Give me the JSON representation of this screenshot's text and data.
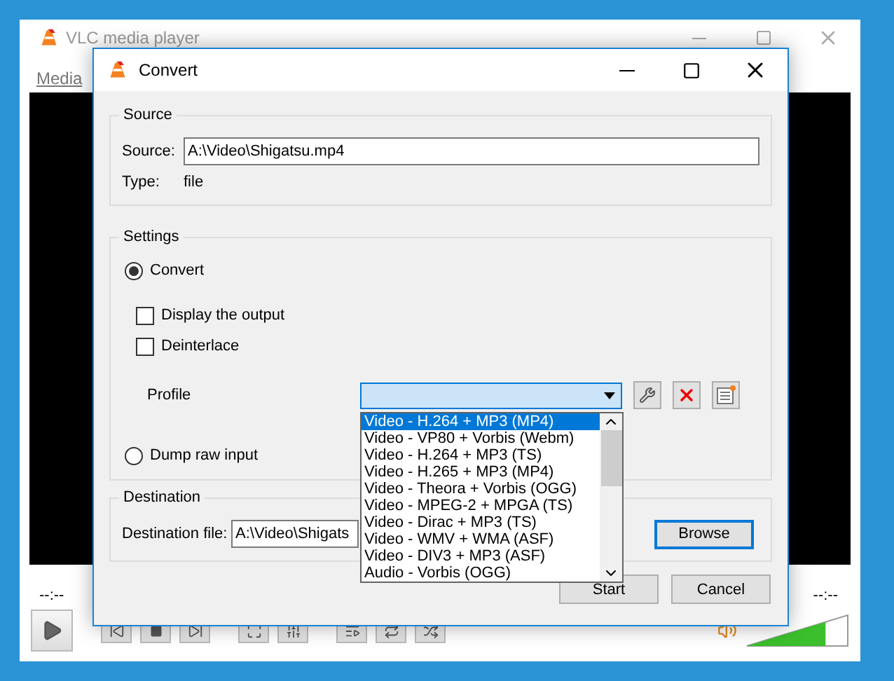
{
  "background_window": {
    "title": "VLC media player",
    "menu": [
      "Media"
    ],
    "time_elapsed": "--:--",
    "time_total": "--:--",
    "volume": {
      "level": 0.78
    }
  },
  "dialog": {
    "title": "Convert",
    "source": {
      "group": "Source",
      "label": "Source:",
      "value": "A:\\Video\\Shigatsu.mp4",
      "type_label": "Type:",
      "type_value": "file"
    },
    "settings": {
      "group": "Settings",
      "modes": [
        {
          "label": "Convert",
          "selected": true
        },
        {
          "label": "Dump raw input",
          "selected": false
        }
      ],
      "options": [
        {
          "label": "Display the output",
          "checked": false
        },
        {
          "label": "Deinterlace",
          "checked": false
        }
      ],
      "profile_label": "Profile",
      "profiles": [
        {
          "label": "Video - H.264 + MP3 (MP4)",
          "selected": true
        },
        {
          "label": "Video - VP80 + Vorbis (Webm)",
          "selected": false
        },
        {
          "label": "Video - H.264 + MP3 (TS)",
          "selected": false
        },
        {
          "label": "Video - H.265 + MP3 (MP4)",
          "selected": false
        },
        {
          "label": "Video - Theora + Vorbis (OGG)",
          "selected": false
        },
        {
          "label": "Video - MPEG-2 + MPGA (TS)",
          "selected": false
        },
        {
          "label": "Video - Dirac + MP3 (TS)",
          "selected": false
        },
        {
          "label": "Video - WMV + WMA (ASF)",
          "selected": false
        },
        {
          "label": "Video - DIV3 + MP3 (ASF)",
          "selected": false
        },
        {
          "label": "Audio - Vorbis (OGG)",
          "selected": false
        }
      ]
    },
    "destination": {
      "group": "Destination",
      "label": "Destination file:",
      "value": "A:\\Video\\Shigats",
      "browse": "Browse"
    },
    "buttons": [
      "Start",
      "Cancel"
    ]
  }
}
